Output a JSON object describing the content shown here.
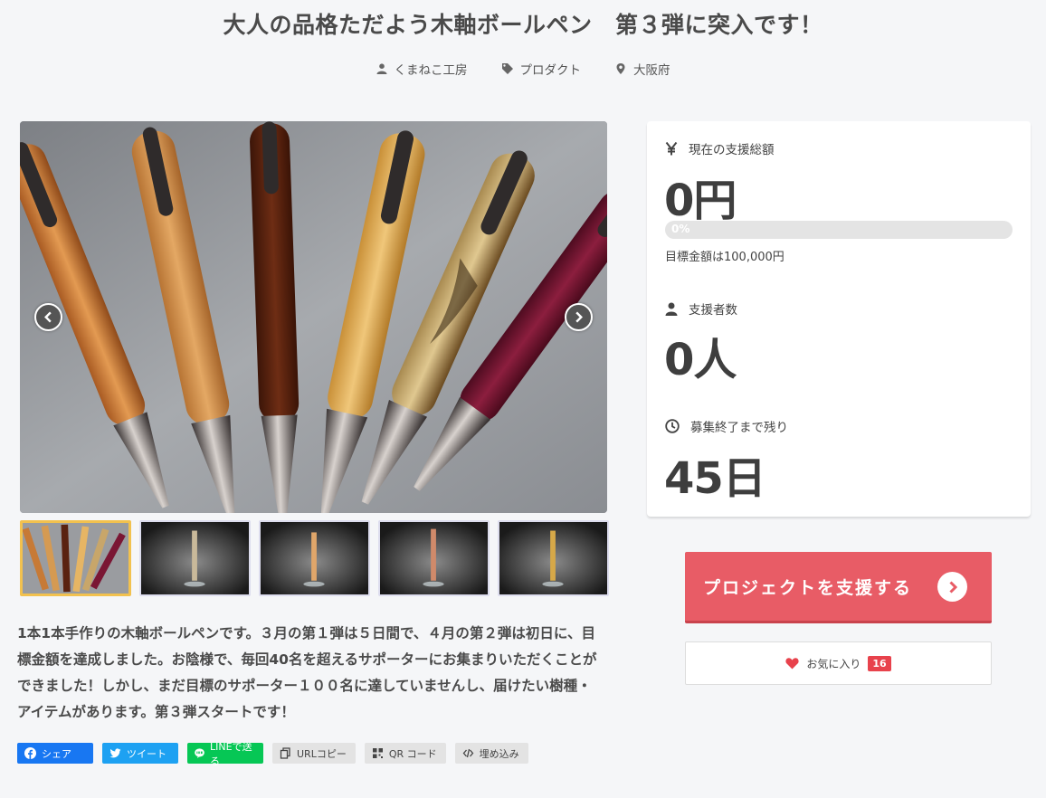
{
  "title": "大人の品格ただよう木軸ボールペン　第３弾に突入です！",
  "meta": {
    "owner": "くまねこ工房",
    "category": "プロダクト",
    "location": "大阪府",
    "icons": [
      "user-icon",
      "tag-icon",
      "map-pin-icon"
    ]
  },
  "gallery": {
    "thumbnail_count": 5,
    "active_index": 0
  },
  "description": "1本1本手作りの木軸ボールペンです。３月の第１弾は５日間で、４月の第２弾は初日に、目標金額を達成しました。お陰様で、毎回40名を超えるサポーターにお集まりいただくことができました！しかし、まだ目標のサポーター１００名に達していませんし、届けたい樹種・アイテムがあります。第３弾スタートです！",
  "share": {
    "facebook": "シェア",
    "twitter": "ツイート",
    "line": "LINEで送る",
    "url_copy": "URLコピー",
    "qr": "QR コード",
    "embed": "埋め込み"
  },
  "stats": {
    "total_label": "現在の支援総額",
    "total_value": "0円",
    "progress_percent": 0,
    "progress_text": "0%",
    "goal_text": "目標金額は100,000円",
    "supporters_label": "支援者数",
    "supporters_value": "0人",
    "remaining_label": "募集終了まで残り",
    "remaining_value": "45日"
  },
  "actions": {
    "support_label": "プロジェクトを支援する",
    "favorite_label": "お気に入り",
    "favorite_count": "16"
  },
  "colors": {
    "accent": "#e85c66",
    "facebook": "#1877f2",
    "twitter": "#1da1f2",
    "line": "#06c755",
    "thumb_active": "#f2c14e"
  }
}
